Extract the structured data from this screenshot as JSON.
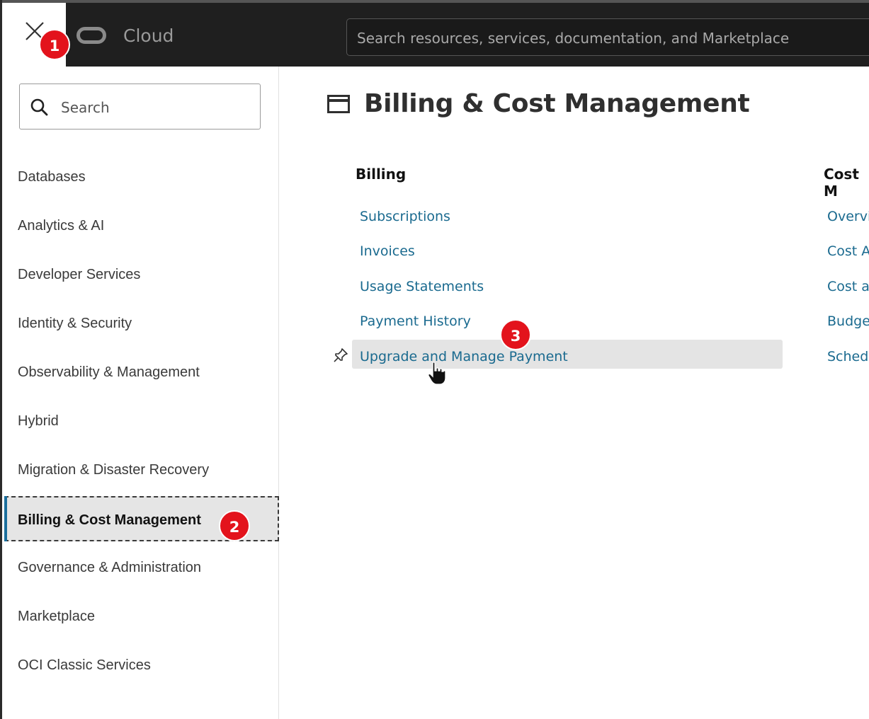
{
  "header": {
    "brand": "Cloud",
    "search_placeholder": "Search resources, services, documentation, and Marketplace"
  },
  "sidebar": {
    "search_placeholder": "Search",
    "items": [
      {
        "label": "Databases"
      },
      {
        "label": "Analytics & AI"
      },
      {
        "label": "Developer Services"
      },
      {
        "label": "Identity & Security"
      },
      {
        "label": "Observability & Management"
      },
      {
        "label": "Hybrid"
      },
      {
        "label": "Migration & Disaster Recovery"
      },
      {
        "label": "Billing & Cost Management",
        "active": true
      },
      {
        "label": "Governance & Administration"
      },
      {
        "label": "Marketplace"
      },
      {
        "label": "OCI Classic Services"
      }
    ]
  },
  "main": {
    "title": "Billing & Cost Management",
    "sections": [
      {
        "heading": "Billing",
        "links": [
          "Subscriptions",
          "Invoices",
          "Usage Statements",
          "Payment History",
          "Upgrade and Manage Payment"
        ]
      },
      {
        "heading": "Cost M",
        "links": [
          "Overvi",
          "Cost A",
          "Cost ar",
          "Budge",
          "Schedu"
        ]
      }
    ]
  },
  "badges": [
    "1",
    "2",
    "3"
  ],
  "colors": {
    "link": "#1a6a8f",
    "badge": "#e3131c",
    "active_indicator": "#1b6f9d",
    "header_bg": "#1f1f1f"
  }
}
